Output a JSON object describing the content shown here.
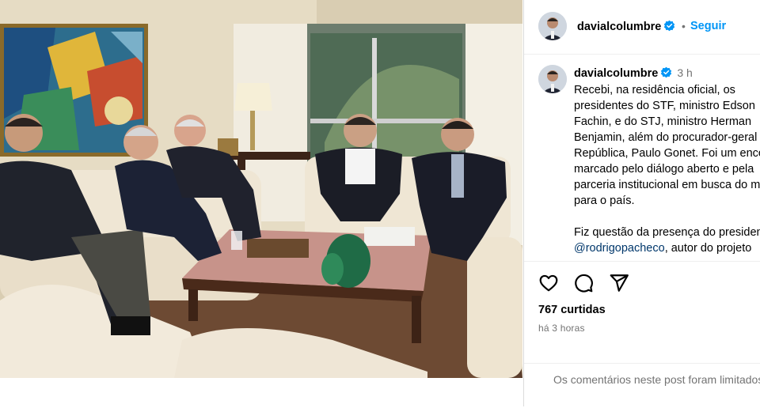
{
  "post": {
    "username": "davialcolumbre",
    "follow_label": "Seguir",
    "dot": "•",
    "time_ago": "3 h",
    "caption_part1": "Recebi, na residência oficial, os presidentes do STF, ministro Edson Fachin, e do STJ, ministro Herman Benjamin, além do procurador-geral da República, Paulo Gonet. Foi um encontro marcado pelo diálogo aberto e pela parceria institucional em busca do melhor para o país.\n\nFiz questão da presença do presidente ",
    "caption_mention": "@rodrigopacheco",
    "caption_part2": ", autor do projeto",
    "likes_text": "767 curtidas",
    "posted_ago": "há 3 horas",
    "comments_disabled_text": "Os comentários neste post foram limitados"
  },
  "icons": {
    "verified": "verified-badge-icon",
    "like": "heart-icon",
    "comment": "comment-bubble-icon",
    "share": "paper-plane-icon"
  },
  "colors": {
    "link_blue": "#0095f6",
    "verified_blue": "#0095f6",
    "secondary_text": "#737373",
    "mention": "#00376b",
    "divider": "#dbdbdb"
  }
}
